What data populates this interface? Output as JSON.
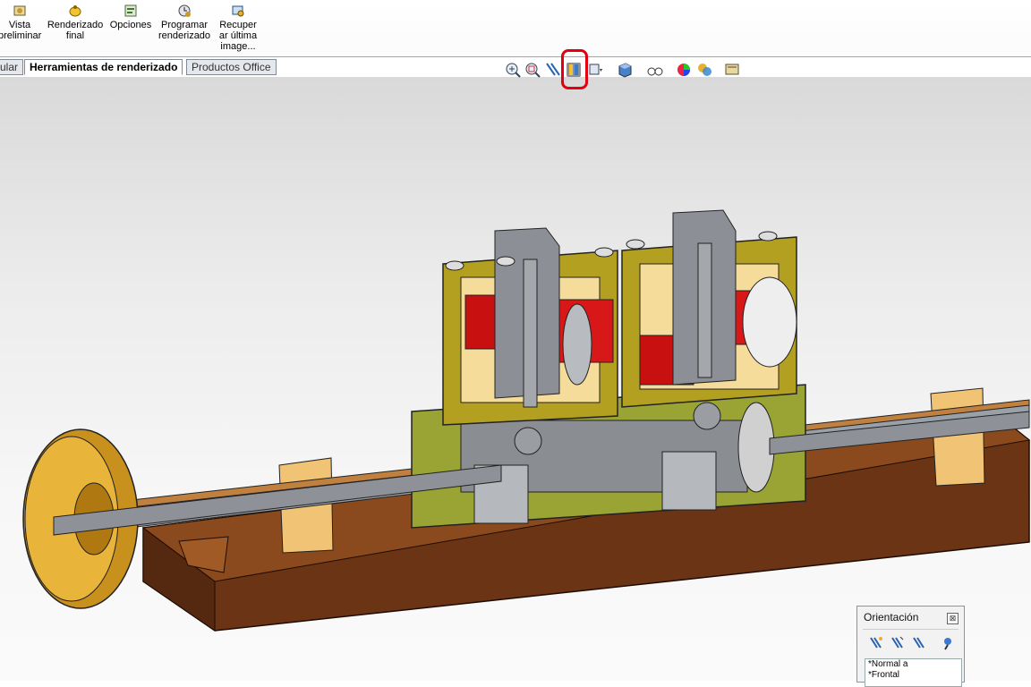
{
  "ribbon": {
    "buttons": [
      {
        "label": "Vista preliminar",
        "icon": "teapot-preview-icon"
      },
      {
        "label": "Renderizado final",
        "icon": "teapot-final-render-icon"
      },
      {
        "label": "Opciones",
        "icon": "options-icon"
      },
      {
        "label": "Programar renderizado",
        "icon": "schedule-render-icon"
      },
      {
        "label": "Recuperar última image...",
        "icon": "recover-image-icon"
      }
    ],
    "labels": {
      "b0l1": "Vista",
      "b0l2": "preliminar",
      "b1l1": "Renderizado",
      "b1l2": "final",
      "b2l1": "Opciones",
      "b3l1": "Programar",
      "b3l2": "renderizado",
      "b4l1": "Recuper",
      "b4l2": "ar última",
      "b4l3": "image..."
    }
  },
  "tabs": [
    {
      "label": "ular",
      "active": false
    },
    {
      "label": "Herramientas de renderizado",
      "active": true
    },
    {
      "label": "Productos Office",
      "active": false
    }
  ],
  "hud_icons": [
    "zoom-to-fit-icon",
    "zoom-area-icon",
    "previous-view-icon",
    "section-view-icon",
    "view-orientation-icon",
    "display-style-icon",
    "hide-show-icon",
    "appearance-icon",
    "scene-icon",
    "view-settings-icon"
  ],
  "highlight_color": "#e00010",
  "orientation": {
    "title": "Orientación",
    "close": "⊠",
    "items": [
      "*Normal a",
      "*Frontal"
    ]
  }
}
